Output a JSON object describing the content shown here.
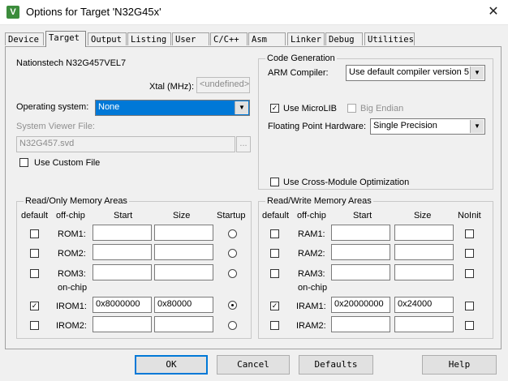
{
  "window": {
    "title": "Options for Target 'N32G45x'",
    "close_glyph": "✕"
  },
  "tabs": [
    "Device",
    "Target",
    "Output",
    "Listing",
    "User",
    "C/C++",
    "Asm",
    "Linker",
    "Debug",
    "Utilities"
  ],
  "active_tab": "Target",
  "device": {
    "name": "Nationstech N32G457VEL7",
    "xtal_label": "Xtal (MHz):",
    "xtal_value": "<undefined>",
    "os_label": "Operating system:",
    "os_value": "None",
    "svd_label": "System Viewer File:",
    "svd_value": "N32G457.svd",
    "browse_label": "...",
    "custom_file_label": "Use Custom File"
  },
  "codegen": {
    "title": "Code Generation",
    "compiler_label": "ARM Compiler:",
    "compiler_value": "Use default compiler version 5",
    "microlib_label": "Use MicroLIB",
    "big_endian_label": "Big Endian",
    "fp_label": "Floating Point Hardware:",
    "fp_value": "Single Precision",
    "cross_module_label": "Use Cross-Module Optimization"
  },
  "ro_memory": {
    "title": "Read/Only Memory Areas",
    "headers": {
      "default": "default",
      "offchip": "off-chip",
      "start": "Start",
      "size": "Size",
      "startup": "Startup"
    },
    "onchip_label": "on-chip",
    "rows": [
      {
        "name": "ROM1:",
        "start": "",
        "size": "",
        "default": false,
        "startup": false
      },
      {
        "name": "ROM2:",
        "start": "",
        "size": "",
        "default": false,
        "startup": false
      },
      {
        "name": "ROM3:",
        "start": "",
        "size": "",
        "default": false,
        "startup": false
      },
      {
        "name": "IROM1:",
        "start": "0x8000000",
        "size": "0x80000",
        "default": true,
        "startup": true
      },
      {
        "name": "IROM2:",
        "start": "",
        "size": "",
        "default": false,
        "startup": false
      }
    ]
  },
  "rw_memory": {
    "title": "Read/Write Memory Areas",
    "headers": {
      "default": "default",
      "offchip": "off-chip",
      "start": "Start",
      "size": "Size",
      "noinit": "NoInit"
    },
    "onchip_label": "on-chip",
    "rows": [
      {
        "name": "RAM1:",
        "start": "",
        "size": "",
        "default": false,
        "noinit": false
      },
      {
        "name": "RAM2:",
        "start": "",
        "size": "",
        "default": false,
        "noinit": false
      },
      {
        "name": "RAM3:",
        "start": "",
        "size": "",
        "default": false,
        "noinit": false
      },
      {
        "name": "IRAM1:",
        "start": "0x20000000",
        "size": "0x24000",
        "default": true,
        "noinit": false
      },
      {
        "name": "IRAM2:",
        "start": "",
        "size": "",
        "default": false,
        "noinit": false
      }
    ]
  },
  "buttons": {
    "ok": "OK",
    "cancel": "Cancel",
    "defaults": "Defaults",
    "help": "Help"
  },
  "check_glyph": "✓",
  "arrow_glyph": "▼"
}
